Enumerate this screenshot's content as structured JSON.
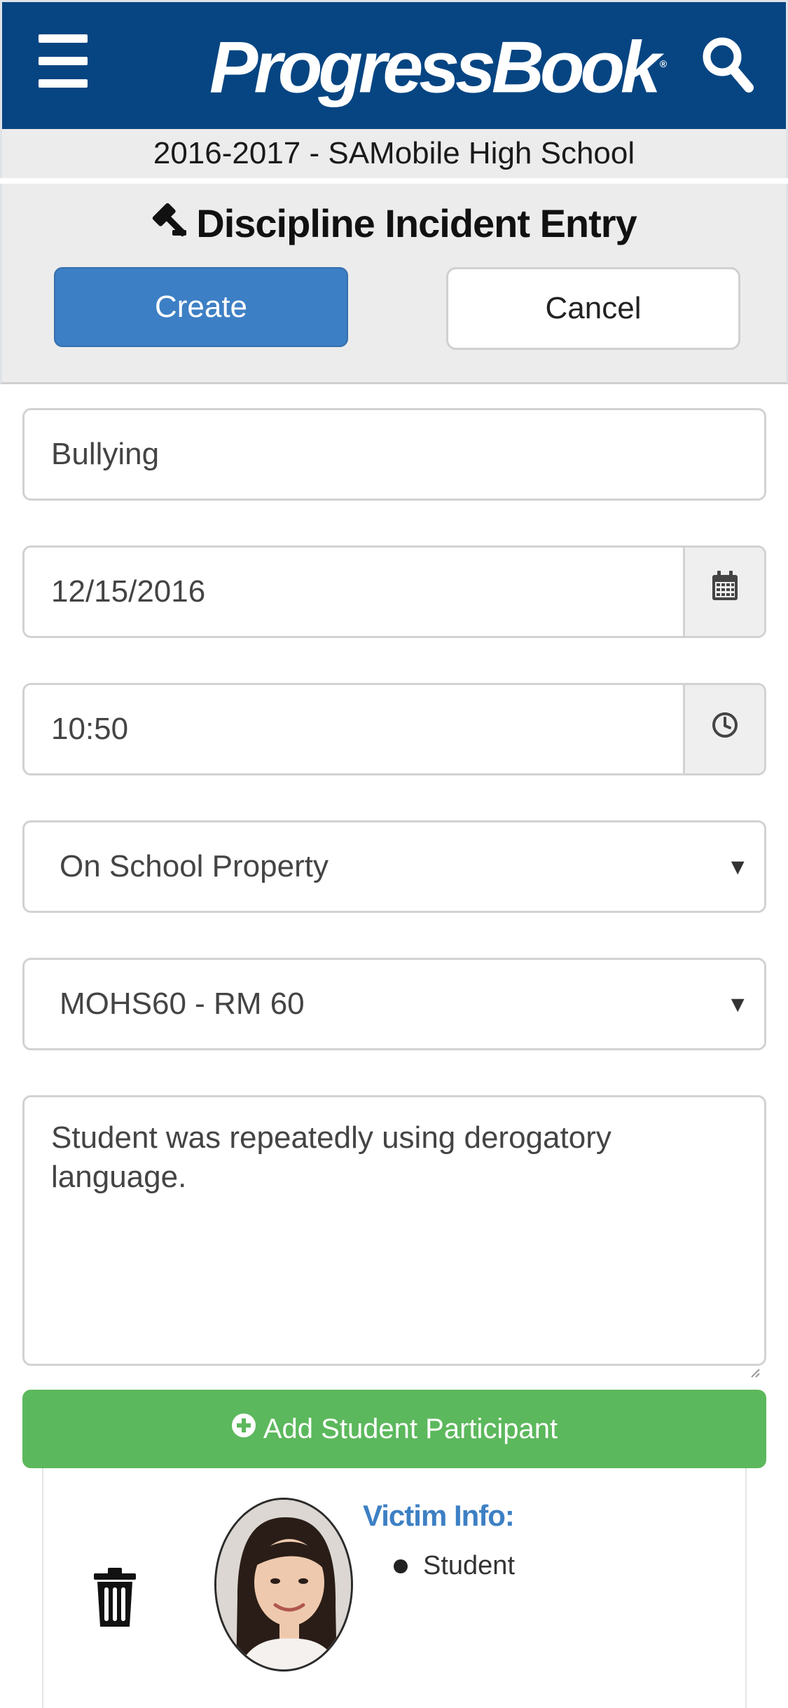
{
  "header": {
    "logo_text": "ProgressBook",
    "logo_mark": "®",
    "brand_color": "#064582",
    "menu_icon": "hamburger-menu-icon",
    "search_icon": "search-icon"
  },
  "school_label": "2016-2017 - SAMobile High School",
  "page": {
    "title": "Discipline Incident Entry",
    "title_icon": "gavel-icon"
  },
  "actions": {
    "create_label": "Create",
    "cancel_label": "Cancel",
    "create_color": "#3d7fc4"
  },
  "form": {
    "incident_type": "Bullying",
    "date": "12/15/2016",
    "date_icon": "calendar-icon",
    "time": "10:50",
    "time_icon": "clock-icon",
    "location": "On School Property",
    "room": "MOHS60 - RM 60",
    "description": "Student was repeatedly using derogatory language."
  },
  "add_participant": {
    "label": "Add Student Participant",
    "icon": "plus-circle-icon",
    "color": "#5cb85c"
  },
  "participant": {
    "heading": "Victim Info:",
    "role": "Student",
    "delete_icon": "trash-icon",
    "heading_color": "#3d80c4"
  }
}
